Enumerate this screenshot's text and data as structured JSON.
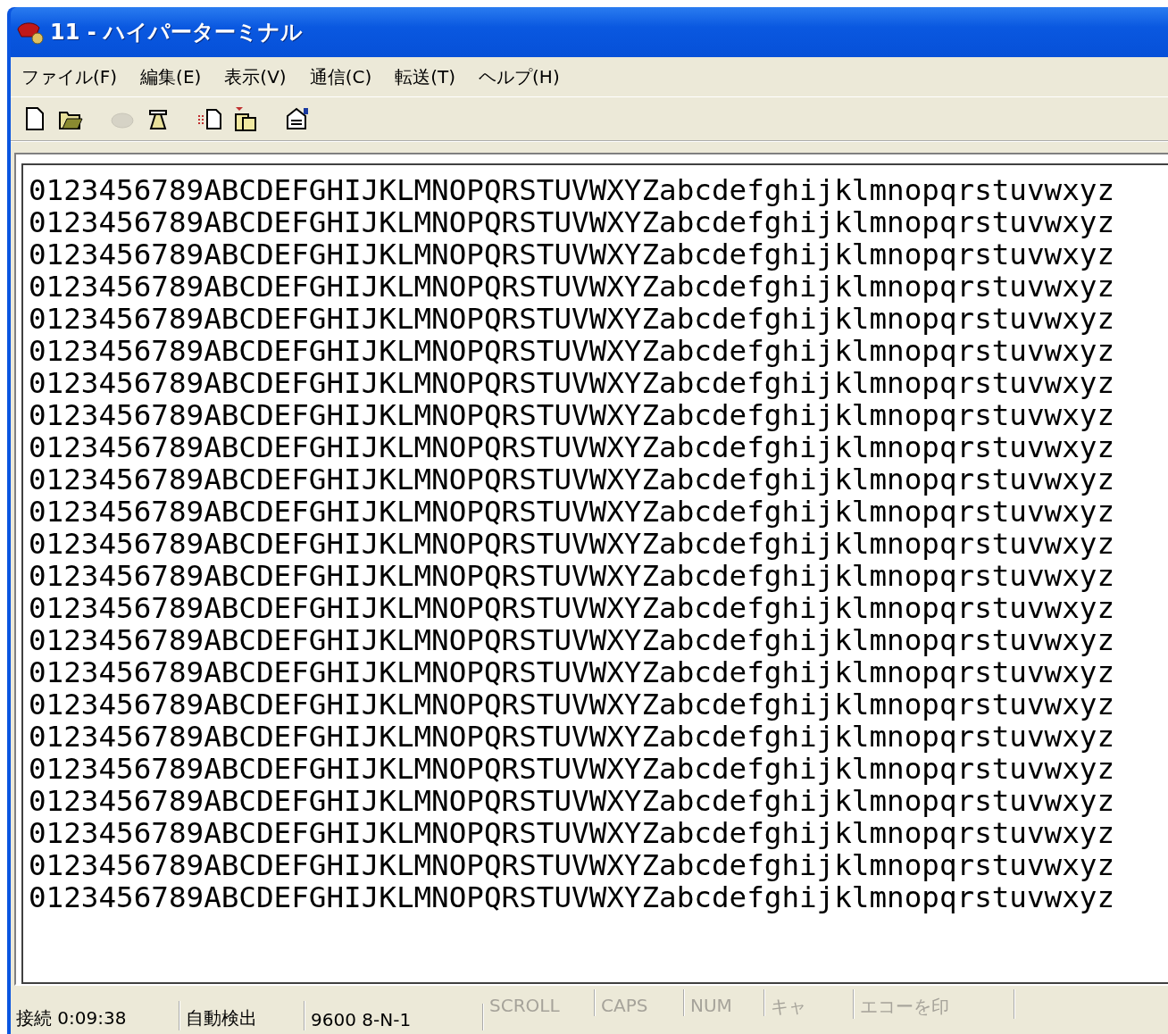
{
  "window": {
    "title": "11 - ハイパーターミナル"
  },
  "menu": [
    {
      "label": "ファイル(F)"
    },
    {
      "label": "編集(E)"
    },
    {
      "label": "表示(V)"
    },
    {
      "label": "通信(C)"
    },
    {
      "label": "転送(T)"
    },
    {
      "label": "ヘルプ(H)"
    }
  ],
  "toolbar": [
    {
      "kind": "new",
      "disabled": false
    },
    {
      "kind": "open",
      "disabled": false
    },
    {
      "kind": "hangup",
      "disabled": true
    },
    {
      "kind": "dial",
      "disabled": false
    },
    {
      "kind": "send",
      "disabled": false
    },
    {
      "kind": "receive",
      "disabled": false
    },
    {
      "kind": "properties",
      "disabled": false
    }
  ],
  "terminal": {
    "lines": [
      "0123456789ABCDEFGHIJKLMNOPQRSTUVWXYZabcdefghijklmnopqrstuvwxyz",
      "0123456789ABCDEFGHIJKLMNOPQRSTUVWXYZabcdefghijklmnopqrstuvwxyz",
      "0123456789ABCDEFGHIJKLMNOPQRSTUVWXYZabcdefghijklmnopqrstuvwxyz",
      "0123456789ABCDEFGHIJKLMNOPQRSTUVWXYZabcdefghijklmnopqrstuvwxyz",
      "0123456789ABCDEFGHIJKLMNOPQRSTUVWXYZabcdefghijklmnopqrstuvwxyz",
      "0123456789ABCDEFGHIJKLMNOPQRSTUVWXYZabcdefghijklmnopqrstuvwxyz",
      "0123456789ABCDEFGHIJKLMNOPQRSTUVWXYZabcdefghijklmnopqrstuvwxyz",
      "0123456789ABCDEFGHIJKLMNOPQRSTUVWXYZabcdefghijklmnopqrstuvwxyz",
      "0123456789ABCDEFGHIJKLMNOPQRSTUVWXYZabcdefghijklmnopqrstuvwxyz",
      "0123456789ABCDEFGHIJKLMNOPQRSTUVWXYZabcdefghijklmnopqrstuvwxyz",
      "0123456789ABCDEFGHIJKLMNOPQRSTUVWXYZabcdefghijklmnopqrstuvwxyz",
      "0123456789ABCDEFGHIJKLMNOPQRSTUVWXYZabcdefghijklmnopqrstuvwxyz",
      "0123456789ABCDEFGHIJKLMNOPQRSTUVWXYZabcdefghijklmnopqrstuvwxyz",
      "0123456789ABCDEFGHIJKLMNOPQRSTUVWXYZabcdefghijklmnopqrstuvwxyz",
      "0123456789ABCDEFGHIJKLMNOPQRSTUVWXYZabcdefghijklmnopqrstuvwxyz",
      "0123456789ABCDEFGHIJKLMNOPQRSTUVWXYZabcdefghijklmnopqrstuvwxyz",
      "0123456789ABCDEFGHIJKLMNOPQRSTUVWXYZabcdefghijklmnopqrstuvwxyz",
      "0123456789ABCDEFGHIJKLMNOPQRSTUVWXYZabcdefghijklmnopqrstuvwxyz",
      "0123456789ABCDEFGHIJKLMNOPQRSTUVWXYZabcdefghijklmnopqrstuvwxyz",
      "0123456789ABCDEFGHIJKLMNOPQRSTUVWXYZabcdefghijklmnopqrstuvwxyz",
      "0123456789ABCDEFGHIJKLMNOPQRSTUVWXYZabcdefghijklmnopqrstuvwxyz",
      "0123456789ABCDEFGHIJKLMNOPQRSTUVWXYZabcdefghijklmnopqrstuvwxyz",
      "0123456789ABCDEFGHIJKLMNOPQRSTUVWXYZabcdefghijklmnopqrstuvwxyz"
    ]
  },
  "status_bar": [
    {
      "text": "接続 0:09:38",
      "active": true
    },
    {
      "text": "自動検出",
      "active": true
    },
    {
      "text": "9600 8-N-1",
      "active": true
    },
    {
      "text": "SCROLL",
      "active": false
    },
    {
      "text": "CAPS",
      "active": false
    },
    {
      "text": "NUM",
      "active": false
    },
    {
      "text": "キャ",
      "active": false
    },
    {
      "text": "エコーを印",
      "active": false
    }
  ]
}
